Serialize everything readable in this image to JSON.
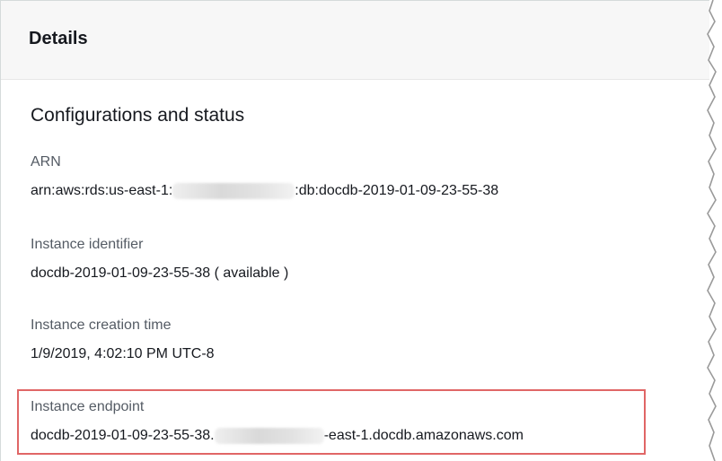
{
  "panel": {
    "title": "Details"
  },
  "section": {
    "title": "Configurations and status"
  },
  "fields": {
    "arn": {
      "label": "ARN",
      "prefix": "arn:aws:rds:us-east-1:",
      "suffix": ":db:docdb-2019-01-09-23-55-38"
    },
    "instance_identifier": {
      "label": "Instance identifier",
      "value": "docdb-2019-01-09-23-55-38 ( available )"
    },
    "creation_time": {
      "label": "Instance creation time",
      "value": "1/9/2019, 4:02:10 PM UTC-8"
    },
    "endpoint": {
      "label": "Instance endpoint",
      "prefix": "docdb-2019-01-09-23-55-38.",
      "suffix": "-east-1.docdb.amazonaws.com"
    }
  },
  "colors": {
    "highlight_border": "#e06666",
    "header_background": "#f7f7f7"
  }
}
